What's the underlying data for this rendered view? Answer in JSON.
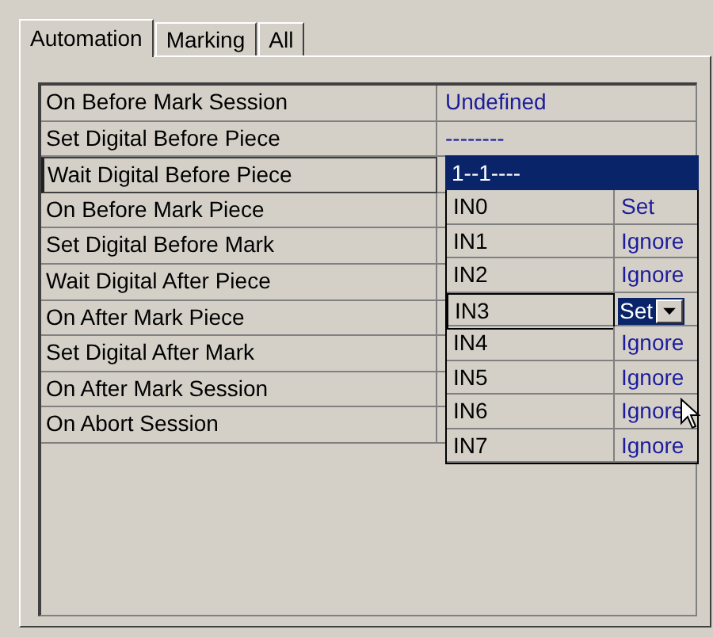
{
  "tabs": [
    {
      "label": "Automation",
      "selected": true
    },
    {
      "label": "Marking",
      "selected": false
    },
    {
      "label": "All",
      "selected": false
    }
  ],
  "properties": [
    {
      "name": "On Before Mark Session",
      "value": "Undefined",
      "selected": false
    },
    {
      "name": "Set Digital Before Piece",
      "value": "--------",
      "selected": false
    },
    {
      "name": "Wait Digital Before Piece",
      "selected": true
    },
    {
      "name": "On Before Mark Piece",
      "selected": false
    },
    {
      "name": "Set Digital Before Mark",
      "selected": false
    },
    {
      "name": "Wait Digital After Piece",
      "selected": false
    },
    {
      "name": "On After Mark Piece",
      "selected": false
    },
    {
      "name": "Set Digital After Mark",
      "selected": false
    },
    {
      "name": "On After Mark Session",
      "selected": false
    },
    {
      "name": "On Abort Session",
      "selected": false
    }
  ],
  "editor": {
    "value": "1--1----",
    "inputs": [
      {
        "name": "IN0",
        "value": "Set",
        "selected": false
      },
      {
        "name": "IN1",
        "value": "Ignore",
        "selected": false
      },
      {
        "name": "IN2",
        "value": "Ignore",
        "selected": false
      },
      {
        "name": "IN3",
        "value": "Set",
        "selected": true
      },
      {
        "name": "IN4",
        "value": "Ignore",
        "selected": false
      },
      {
        "name": "IN5",
        "value": "Ignore",
        "selected": false
      },
      {
        "name": "IN6",
        "value": "Ignore",
        "selected": false
      },
      {
        "name": "IN7",
        "value": "Ignore",
        "selected": false
      }
    ]
  }
}
